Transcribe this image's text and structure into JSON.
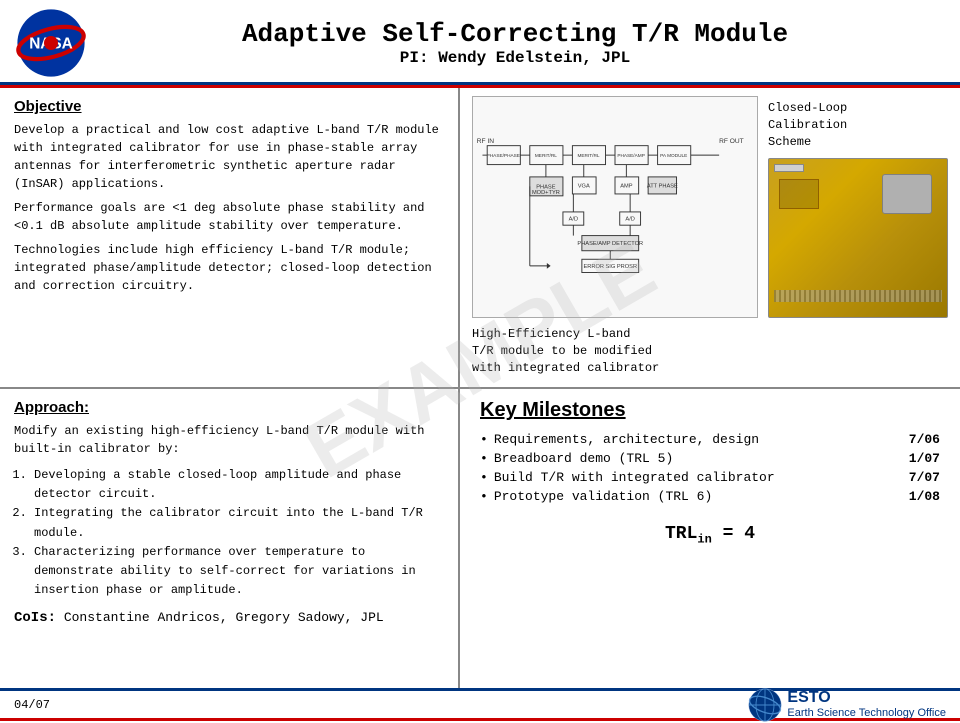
{
  "header": {
    "title": "Adaptive Self-Correcting T/R Module",
    "subtitle": "PI: Wendy Edelstein, JPL"
  },
  "objective": {
    "title": "Objective",
    "paragraphs": [
      "Develop a practical and low cost  adaptive L-band T/R module with integrated calibrator for use in phase-stable array antennas for interferometric synthetic aperture radar (InSAR) applications.",
      "Performance goals are <1 deg absolute phase stability and <0.1 dB absolute amplitude stability over temperature.",
      "Technologies  include high efficiency L-band T/R module; integrated phase/amplitude detector; closed-loop detection and correction circuitry."
    ]
  },
  "approach": {
    "title": "Approach:",
    "intro": "Modify an existing high-efficiency L-band T/R module with built-in calibrator by:",
    "steps": [
      "Developing a stable closed-loop amplitude and phase detector circuit.",
      "Integrating the calibrator circuit into the L-band T/R module.",
      "Characterizing performance over temperature to demonstrate ability to self-correct for variations in insertion phase or amplitude."
    ]
  },
  "milestones": {
    "title": "Key Milestones",
    "items": [
      {
        "label": "Requirements, architecture, design",
        "date": "7/06"
      },
      {
        "label": "Breadboard demo (TRL 5)",
        "date": "1/07"
      },
      {
        "label": "Build T/R with integrated calibrator",
        "date": "7/07"
      },
      {
        "label": "Prototype validation (TRL 6)",
        "date": "1/08"
      }
    ]
  },
  "trl": {
    "label": "TRL",
    "subscript": "in",
    "value": " = 4"
  },
  "diagram": {
    "closed_loop_label": "Closed-Loop\nCalibration\nScheme",
    "hardware_label": "High-Efficiency L-band\nT/R module to be modified\nwith integrated calibrator"
  },
  "cois": {
    "label": "CoIs:",
    "names": "Constantine Andricos, Gregory Sadowy, JPL"
  },
  "footer": {
    "date": "04/07",
    "esto_name": "ESTO",
    "esto_subtitle": "Earth Science Technology Office"
  },
  "watermark": "EXAMPLE"
}
